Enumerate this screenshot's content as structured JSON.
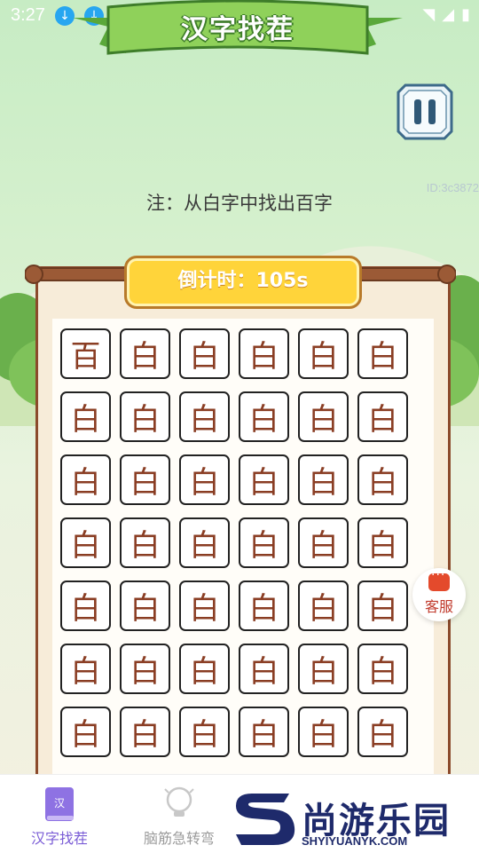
{
  "status_bar": {
    "time": "3:27",
    "download_icons": [
      "download-icon",
      "download-icon",
      "download-icon"
    ]
  },
  "banner": {
    "title": "汉字找茬"
  },
  "note": "注：从白字中找出百字",
  "watermark_id": "ID:3c3872",
  "timer": {
    "label": "倒计时：",
    "value": "105s"
  },
  "grid": {
    "rows": [
      [
        "百",
        "白",
        "白",
        "白",
        "白",
        "白"
      ],
      [
        "白",
        "白",
        "白",
        "白",
        "白",
        "白"
      ],
      [
        "白",
        "白",
        "白",
        "白",
        "白",
        "白"
      ],
      [
        "白",
        "白",
        "白",
        "白",
        "白",
        "白"
      ],
      [
        "白",
        "白",
        "白",
        "白",
        "白",
        "白"
      ],
      [
        "白",
        "白",
        "白",
        "白",
        "白",
        "白"
      ],
      [
        "白",
        "白",
        "白",
        "白",
        "白",
        "白"
      ]
    ]
  },
  "service": {
    "label": "客服"
  },
  "tabs": [
    {
      "label": "汉字找茬",
      "icon_text": "汉",
      "active": true
    },
    {
      "label": "脑筋急转弯",
      "active": false
    }
  ],
  "brand": {
    "name": "尚游乐园",
    "url": "SHYIYUANYK.COM"
  },
  "colors": {
    "accent": "#7a5cd6",
    "board_border": "#8b4a2b",
    "timer_bg": "#ffd43a",
    "char": "#8a3d23"
  }
}
